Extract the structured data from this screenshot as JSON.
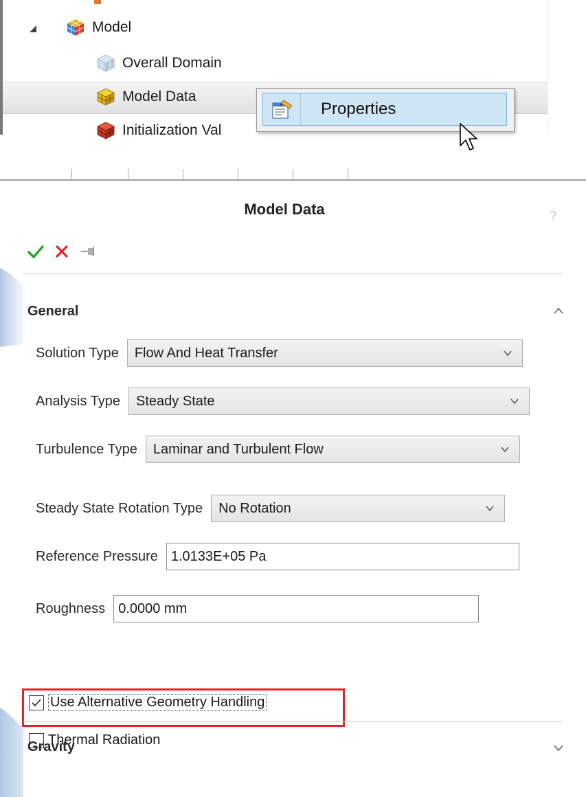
{
  "tree": {
    "root": {
      "label": "Model",
      "icon": "cube-multicolor-icon"
    },
    "children": [
      {
        "label": "Overall Domain",
        "icon": "cube-translucent-icon"
      },
      {
        "label": "Model Data",
        "icon": "cube-yellow-icon",
        "selected": true
      },
      {
        "label": "Initialization Val",
        "icon": "cube-red-icon"
      }
    ]
  },
  "context_menu": {
    "items": [
      {
        "label": "Properties",
        "icon": "properties-icon"
      }
    ]
  },
  "panel": {
    "title": "Model Data",
    "help_glyph": "?",
    "actions": {
      "accept": "check-icon",
      "cancel": "x-icon",
      "pin": "pin-icon"
    },
    "general": {
      "header": "General",
      "fields": {
        "solution_type": {
          "label": "Solution Type",
          "value": "Flow And Heat Transfer"
        },
        "analysis_type": {
          "label": "Analysis Type",
          "value": "Steady State"
        },
        "turbulence_type": {
          "label": "Turbulence Type",
          "value": "Laminar and Turbulent Flow"
        },
        "rotation_type": {
          "label": "Steady State Rotation Type",
          "value": "No Rotation"
        },
        "reference_pressure": {
          "label": "Reference Pressure",
          "value": "1.0133E+05 Pa"
        },
        "roughness": {
          "label": "Roughness",
          "value": "0.0000 mm"
        }
      },
      "checkboxes": {
        "alt_geometry": {
          "label": "Use Alternative Geometry Handling",
          "checked": true
        },
        "thermal_radiation": {
          "label": "Thermal Radiation",
          "checked": false
        }
      }
    },
    "gravity": {
      "header": "Gravity"
    }
  },
  "colors": {
    "highlight": "#e0242c",
    "accept": "#2e9d2e",
    "cancel": "#e02424",
    "menu_hover": "#cfe6f6"
  }
}
